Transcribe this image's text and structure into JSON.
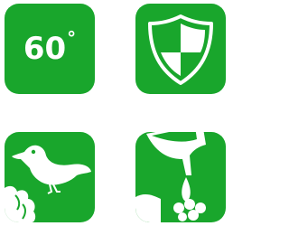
{
  "icons": [
    {
      "name": "temperature-60-icon",
      "label": "60",
      "unit": "°",
      "color": "#19a62c"
    },
    {
      "name": "shield-icon",
      "color": "#19a62c"
    },
    {
      "name": "bird-icon",
      "color": "#19a62c"
    },
    {
      "name": "chemical-pour-icon",
      "color": "#19a62c"
    }
  ]
}
